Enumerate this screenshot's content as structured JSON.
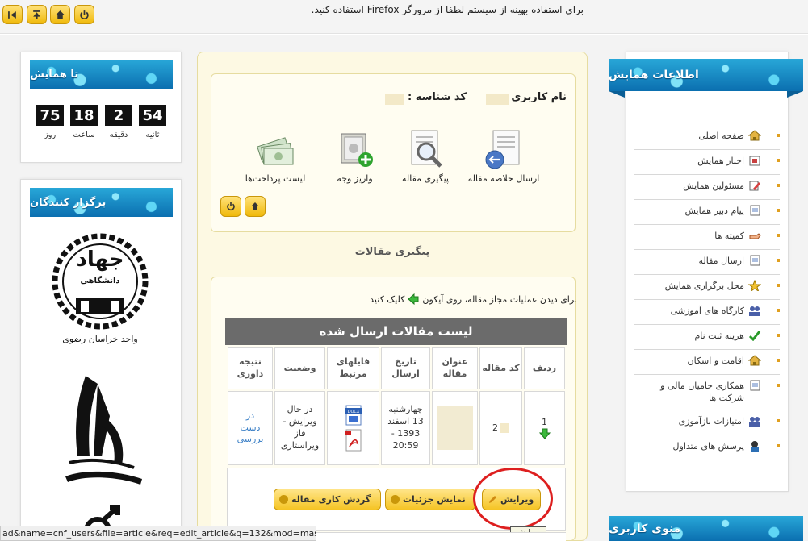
{
  "topbar": {
    "message": "براي استفاده بهينه از سيستم لطفا از مرورگر Firefox استفاده کنيد."
  },
  "left": {
    "countdown_title": "تا همایش",
    "countdown": [
      {
        "value": "54",
        "label": "ثانیه"
      },
      {
        "value": "2",
        "label": "دقیقه"
      },
      {
        "value": "18",
        "label": "ساعت"
      },
      {
        "value": "75",
        "label": "روز"
      }
    ],
    "organizers_title": "برگزار کنندگان",
    "logo1_caption": "واحد خراسان رضوی",
    "logo1_heading": "جهاد",
    "logo1_sub": "دانشگاهی"
  },
  "user": {
    "username_label": "نام کاربری :",
    "id_label": "کد شناسه :"
  },
  "quick_icons": [
    {
      "label": "ارسال خلاصه مقاله"
    },
    {
      "label": "پیگیری مقاله"
    },
    {
      "label": "واریز وجه"
    },
    {
      "label": "لیست پرداخت‌ها"
    }
  ],
  "section_title": "پیگیری مقالات",
  "hint": "برای دیدن عملیات مجاز مقاله، روی آیکون",
  "hint_tail": "کلیک کنید",
  "table": {
    "title": "لیست مقالات ارسال شده",
    "headers": [
      "ردیف",
      "کد مقاله",
      "عنوان مقاله",
      "تاریخ ارسال",
      "فایلهای مرتبط",
      "وضعیت",
      "نتیجه داوری"
    ],
    "row": {
      "index": "1",
      "code": "2",
      "date": "چهارشنبه 13 اسفند 1393 - 20:59",
      "file1_label": "DOCX",
      "status": "در حال ویرایش - فاز ویراستاری",
      "result": "در دست بررسی"
    },
    "actions": [
      "ویرایش",
      "نمایش جزئیات",
      "گردش کاری مقاله"
    ],
    "tooltip": "ویرایش"
  },
  "statusbar": "ad&name=cnf_users&file=article&req=edit_article&q=132&mod=master",
  "right": {
    "info_title": "اطلاعات همایش",
    "menu": [
      {
        "label": "صفحه اصلی",
        "icon": "home-icon"
      },
      {
        "label": "اخبار همایش",
        "icon": "news-icon"
      },
      {
        "label": "مسئولین همایش",
        "icon": "edit-icon"
      },
      {
        "label": "پیام دبیر همایش",
        "icon": "document-icon"
      },
      {
        "label": "کمیته ها",
        "icon": "hand-icon"
      },
      {
        "label": "ارسال مقاله",
        "icon": "document-icon"
      },
      {
        "label": "محل برگزاری همایش",
        "icon": "star-icon"
      },
      {
        "label": "کارگاه های آموزشی",
        "icon": "users-icon"
      },
      {
        "label": "هزینه ثبت نام",
        "icon": "check-icon"
      },
      {
        "label": "اقامت و اسکان",
        "icon": "home-icon"
      },
      {
        "label": "همکاری حامیان مالی و شرکت ها",
        "icon": "document-icon"
      },
      {
        "label": "امتیازات بازآموزی",
        "icon": "users-icon"
      },
      {
        "label": "پرسش های متداول",
        "icon": "user-icon"
      }
    ],
    "user_menu_title": "منوی کاربری"
  },
  "colors": {
    "accent_yellow": "#f0b90b",
    "header_blue": "#1a8cc8",
    "table_head": "#6b6b6b",
    "highlight_red": "#dd1f1f"
  }
}
